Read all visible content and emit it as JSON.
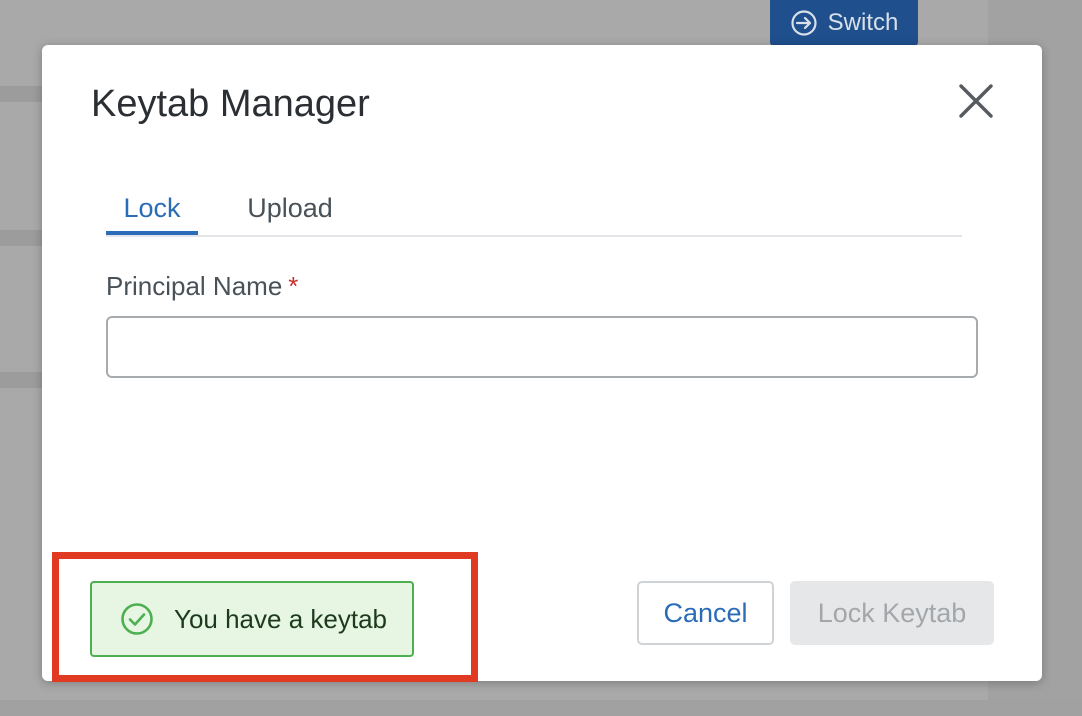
{
  "background": {
    "switch_label": "Switch",
    "switch_icon": "arrow-right-circle-icon"
  },
  "modal": {
    "title": "Keytab Manager",
    "close_icon": "close-icon",
    "tabs": [
      {
        "label": "Lock",
        "active": true
      },
      {
        "label": "Upload",
        "active": false
      }
    ],
    "field": {
      "label": "Principal Name",
      "required_mark": "*",
      "value": "",
      "placeholder": ""
    },
    "status": {
      "icon": "check-circle-icon",
      "text": "You have a keytab",
      "color": "#4caf50"
    },
    "buttons": {
      "cancel": "Cancel",
      "lock_keytab": "Lock Keytab"
    }
  },
  "colors": {
    "accent": "#2a6cb8",
    "success_border": "#4caf50",
    "success_bg": "#e6f6e3",
    "required": "#c9302c",
    "annotation": "#e03a22"
  }
}
